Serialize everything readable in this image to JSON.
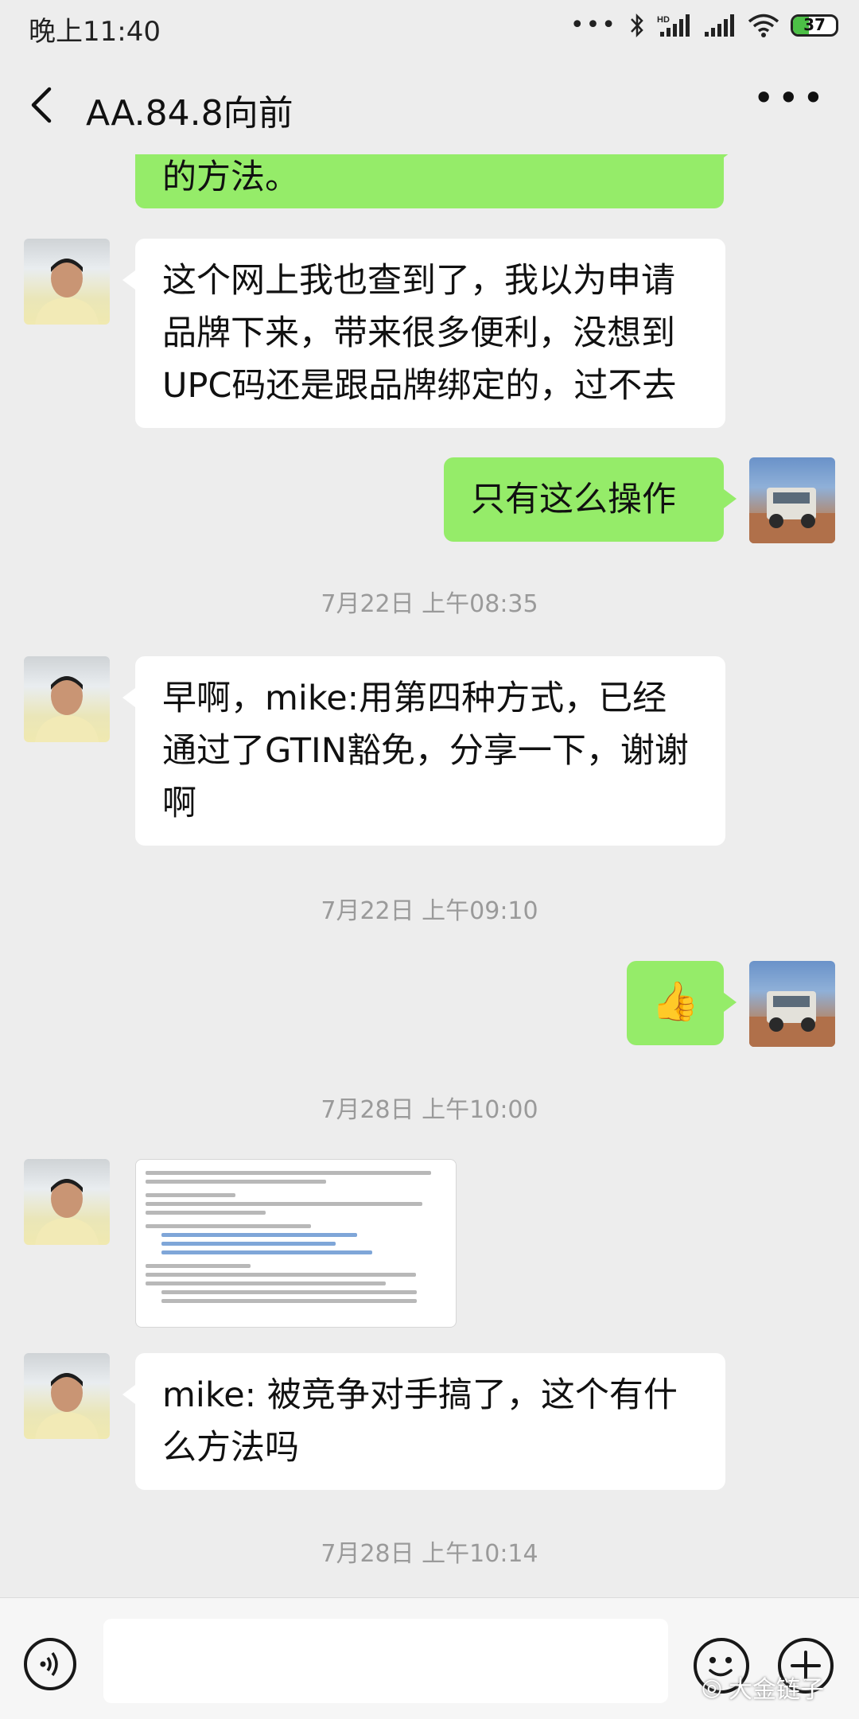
{
  "status_bar": {
    "time": "晚上11:40",
    "battery_level": "37",
    "battery_fraction": 0.37,
    "icons": [
      "dots-icon",
      "bluetooth-icon",
      "hd-signal-icon",
      "signal-icon",
      "wifi-icon",
      "battery-icon"
    ]
  },
  "header": {
    "back_icon": "chevron-left-icon",
    "title": "AA.84.8向前",
    "more_icon": "more-dots-icon"
  },
  "messages": [
    {
      "side": "out",
      "type": "text",
      "text": "的方法。"
    },
    {
      "side": "in",
      "type": "text",
      "text": "这个网上我也查到了，我以为申请品牌下来，带来很多便利，没想到UPC码还是跟品牌绑定的，过不去"
    },
    {
      "side": "out",
      "type": "text",
      "text": "只有这么操作"
    },
    {
      "type": "timestamp",
      "text": "7月22日 上午08:35"
    },
    {
      "side": "in",
      "type": "text",
      "text": "早啊，mike:用第四种方式，已经通过了GTIN豁免，分享一下，谢谢啊"
    },
    {
      "type": "timestamp",
      "text": "7月22日 上午09:10"
    },
    {
      "side": "out",
      "type": "emoji",
      "text": "👍"
    },
    {
      "type": "timestamp",
      "text": "7月28日 上午10:00"
    },
    {
      "side": "in",
      "type": "image",
      "icon": "document-screenshot-image"
    },
    {
      "side": "in",
      "type": "text",
      "text": "mike: 被竞争对手搞了，这个有什么方法吗"
    },
    {
      "type": "timestamp",
      "text": "7月28日 上午10:14"
    }
  ],
  "input_bar": {
    "voice_icon": "voice-icon",
    "emoji_icon": "emoji-icon",
    "plus_icon": "plus-icon",
    "input_value": ""
  },
  "watermark": {
    "text": "大金链子"
  }
}
